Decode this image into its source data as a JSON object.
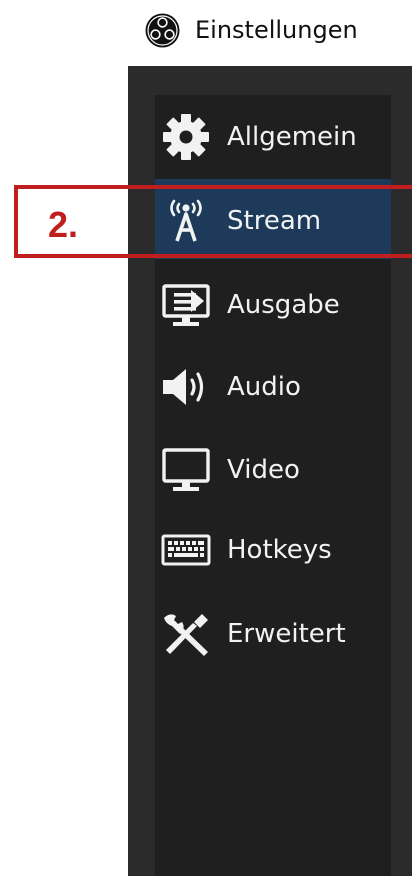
{
  "window": {
    "title": "Einstellungen",
    "logo_icon": "obs-logo-icon"
  },
  "sidebar": {
    "selected_index": 1,
    "items": [
      {
        "label": "Allgemein",
        "icon": "gear-icon"
      },
      {
        "label": "Stream",
        "icon": "antenna-broadcast-icon"
      },
      {
        "label": "Ausgabe",
        "icon": "monitor-output-icon"
      },
      {
        "label": "Audio",
        "icon": "speaker-icon"
      },
      {
        "label": "Video",
        "icon": "monitor-icon"
      },
      {
        "label": "Hotkeys",
        "icon": "keyboard-icon"
      },
      {
        "label": "Erweitert",
        "icon": "wrench-screwdriver-icon"
      }
    ]
  },
  "annotation": {
    "label": "2.",
    "color": "#c11f1f"
  },
  "colors": {
    "frame": "#2b2b2b",
    "sidebar": "#1f1f1f",
    "selected": "#1d3a5a",
    "text": "#f2f2f2"
  }
}
